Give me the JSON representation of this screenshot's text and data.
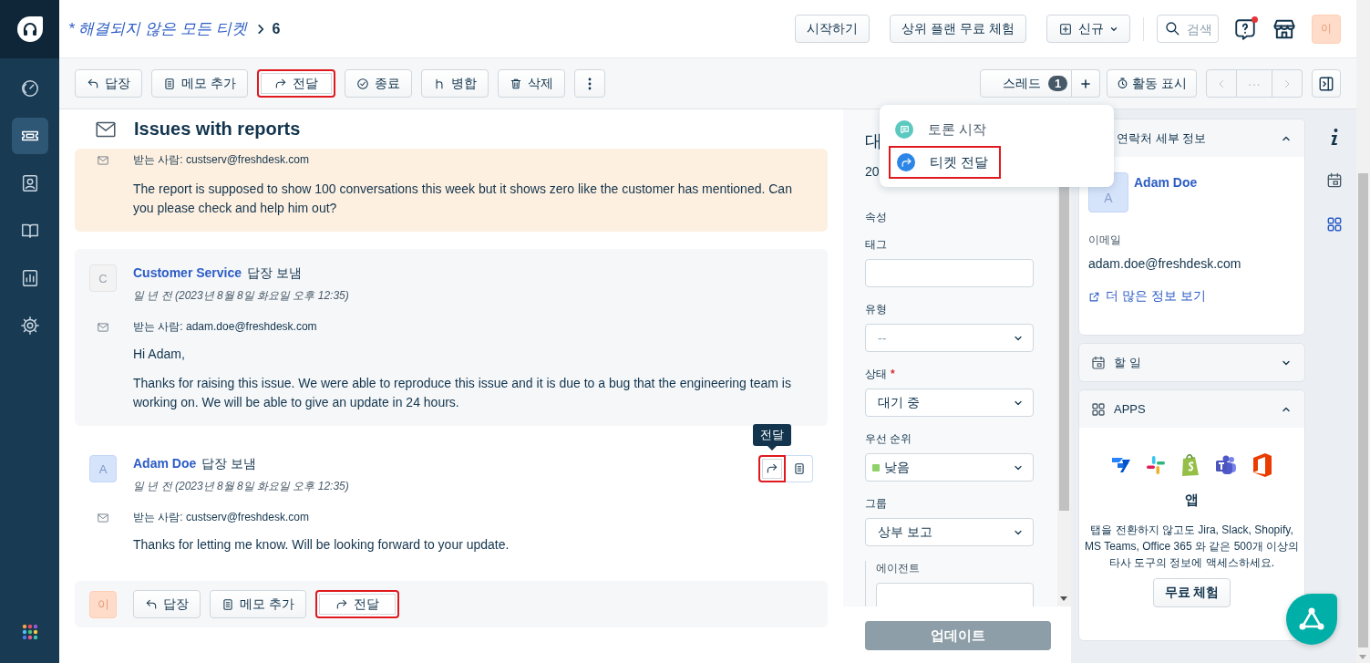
{
  "sidebar": {
    "items": [
      {
        "kind": "dashboard",
        "selected": false
      },
      {
        "kind": "tickets",
        "selected": true
      },
      {
        "kind": "contacts",
        "selected": false
      },
      {
        "kind": "knowledge",
        "selected": false
      },
      {
        "kind": "reports",
        "selected": false
      },
      {
        "kind": "settings",
        "selected": false
      }
    ]
  },
  "header": {
    "breadcrumb": "* 해결되지 않은 모든 티켓",
    "count": "6",
    "buttons": [
      "시작하기",
      "상위 플랜 무료 체험"
    ],
    "new_button": "신규",
    "search": {
      "placeholder": "검색"
    },
    "help_notification": true,
    "avatar": "이"
  },
  "toolbar": {
    "actions": [
      {
        "kind": "reply",
        "label": "답장",
        "highlighted": false
      },
      {
        "kind": "note",
        "label": "메모 추가",
        "highlighted": false
      },
      {
        "kind": "forward",
        "label": "전달",
        "highlighted": true
      },
      {
        "kind": "close",
        "label": "종료",
        "highlighted": false
      },
      {
        "kind": "merge",
        "label": "병합",
        "highlighted": false
      },
      {
        "kind": "delete",
        "label": "삭제",
        "highlighted": false
      }
    ],
    "thread": {
      "label": "스레드",
      "count": "1"
    },
    "activity": "활동 표시",
    "pager": "···"
  },
  "menu": {
    "items": [
      {
        "kind": "discussion",
        "label": "토론 시작",
        "highlighted": false
      },
      {
        "kind": "forward",
        "label": "티켓 전달",
        "highlighted": true
      }
    ]
  },
  "conversation": {
    "title": "Issues with reports",
    "messages": [
      {
        "kind": "note",
        "to_label": "받는 사람:",
        "to": "custserv@freshdesk.com",
        "body": [
          "The report is supposed to show 100 conversations this week but it shows zero like the customer has mentioned. Can you please check and help him out?"
        ]
      },
      {
        "kind": "agent",
        "avatar": "C",
        "author": "Customer Service",
        "action": "답장 보냄",
        "time": "일 년 전 (2023년 8월 8일 화요일 오후 12:35)",
        "to_label": "받는 사람:",
        "to": "adam.doe@freshdesk.com",
        "body": [
          "Hi Adam,",
          "Thanks for raising this issue. We were able to reproduce this issue and it is due to a bug that the engineering team is working on. We will be able to give an update in 24 hours."
        ]
      },
      {
        "kind": "customer",
        "avatar": "A",
        "author": "Adam Doe",
        "action": "답장 보냄",
        "time": "일 년 전 (2023년 8월 8일 화요일 오후 12:35)",
        "to_label": "받는 사람:",
        "to": "custserv@freshdesk.com",
        "body": [
          "Thanks for letting me know. Will be looking forward to your update."
        ],
        "actions": [
          {
            "kind": "forward",
            "highlighted": true,
            "tooltip": "전달"
          },
          {
            "kind": "note",
            "highlighted": false
          }
        ]
      }
    ],
    "reply_bar": {
      "avatar": "이",
      "buttons": [
        {
          "kind": "reply",
          "label": "답장",
          "highlighted": false
        },
        {
          "kind": "note",
          "label": "메모 추가",
          "highlighted": false
        },
        {
          "kind": "forward",
          "label": "전달",
          "highlighted": true
        }
      ]
    }
  },
  "properties": {
    "heading": "대",
    "subheading": "20",
    "section": "속성",
    "fields": [
      {
        "kind": "input",
        "label": "태그"
      },
      {
        "kind": "select",
        "label": "유형",
        "placeholder": "--"
      },
      {
        "kind": "select",
        "label": "상태",
        "required_mark": "*",
        "value": "대기 중"
      },
      {
        "kind": "select",
        "label": "우선 순위",
        "value": "낮음",
        "color": "#8fd16a"
      },
      {
        "kind": "select",
        "label": "그룹",
        "value": "상부 보고"
      },
      {
        "kind": "input",
        "label": "에이전트",
        "nested": true
      }
    ],
    "update_button": {
      "label": "업데이트",
      "disabled": true
    }
  },
  "contact": {
    "title": "연락처 세부 정보",
    "expanded": true,
    "avatar": "A",
    "name": "Adam Doe",
    "email_label": "이메일",
    "email": "adam.doe@freshdesk.com",
    "more_link": "더 많은 정보 보기"
  },
  "todo": {
    "title": "할 일",
    "expanded": false
  },
  "apps": {
    "title": "APPS",
    "expanded": true,
    "heading": "앱",
    "description": "탭을 전환하지 않고도 Jira, Slack, Shopify, MS Teams, Office 365 와 같은 500개 이상의 타사 도구의 정보에 액세스하세요.",
    "button": "무료 체험"
  }
}
